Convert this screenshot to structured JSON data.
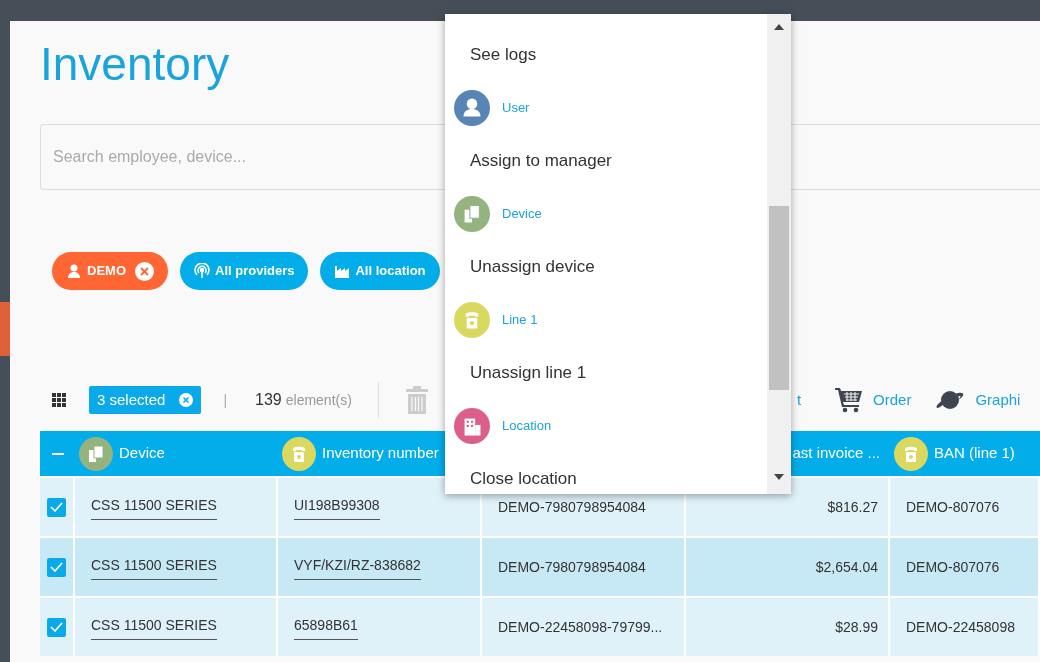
{
  "page_title": "Inventory",
  "search": {
    "placeholder": "Search employee, device..."
  },
  "filters": [
    {
      "kind": "employee",
      "label": "DEMO",
      "removable": true
    },
    {
      "kind": "provider",
      "label": "All providers",
      "removable": false
    },
    {
      "kind": "location",
      "label": "All location",
      "removable": false
    }
  ],
  "toolbar": {
    "selection": "3 selected",
    "count": "139",
    "count_unit": "element(s)",
    "separator": "|",
    "delete_disabled": true,
    "actions": [
      {
        "kind": "plain",
        "label": "t"
      },
      {
        "kind": "order",
        "label": "Order"
      },
      {
        "kind": "graphic",
        "label": "Graphi"
      }
    ]
  },
  "table": {
    "partially_selected": true,
    "columns": [
      {
        "kind": "link",
        "label": "Device"
      },
      {
        "kind": "link",
        "label": "Inventory number"
      },
      {
        "kind": "text"
      },
      {
        "kind": "amount",
        "label": "ast invoice ..."
      },
      {
        "kind": "text",
        "label": "BAN (line 1)"
      }
    ],
    "rows": [
      {
        "selected": true,
        "hovered": false,
        "cells": [
          "CSS 11500 SERIES",
          "UI198B99308",
          "DEMO-7980798954084",
          "$816.27",
          "DEMO-807076"
        ]
      },
      {
        "selected": true,
        "hovered": true,
        "cells": [
          "CSS 11500 SERIES",
          "VYF/KZI/RZ-838682",
          "DEMO-7980798954084",
          "$2,654.04",
          "DEMO-807076"
        ]
      },
      {
        "selected": true,
        "hovered": false,
        "cells": [
          "CSS 11500 SERIES",
          "65898B61",
          "DEMO-22458098-79799...",
          "$28.99",
          "DEMO-22458098"
        ]
      }
    ]
  },
  "menu": {
    "items": [
      {
        "kind": "action",
        "label": "See logs"
      },
      {
        "kind": "user",
        "label": "User"
      },
      {
        "kind": "action",
        "label": "Assign to manager"
      },
      {
        "kind": "device",
        "label": "Device"
      },
      {
        "kind": "action",
        "label": "Unassign device"
      },
      {
        "kind": "line",
        "label": "Line 1"
      },
      {
        "kind": "action",
        "label": "Unassign line 1"
      },
      {
        "kind": "location",
        "label": "Location"
      },
      {
        "kind": "action",
        "label": "Close location"
      }
    ]
  }
}
